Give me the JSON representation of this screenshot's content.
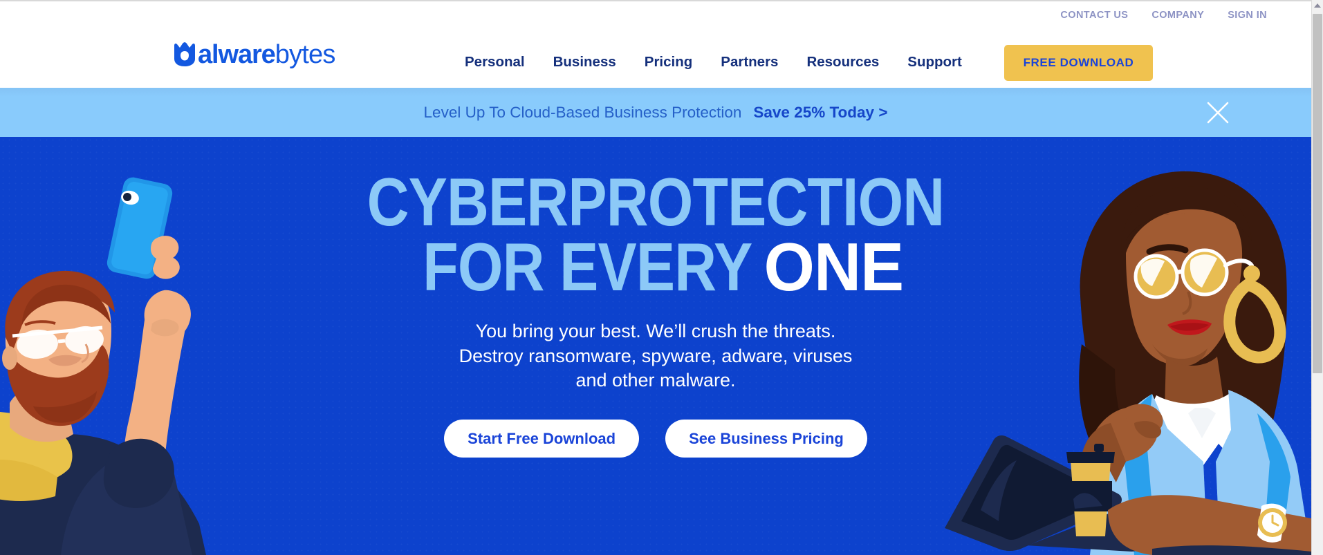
{
  "header": {
    "utility_nav": [
      {
        "label": "CONTACT US",
        "name": "contact-us"
      },
      {
        "label": "COMPANY",
        "name": "company"
      },
      {
        "label": "SIGN IN",
        "name": "sign-in"
      }
    ],
    "logo": {
      "bold_text": "alware",
      "light_text": "bytes",
      "mark": "malwarebytes-m-icon",
      "color": "#1358e0"
    },
    "main_nav": [
      {
        "label": "Personal"
      },
      {
        "label": "Business"
      },
      {
        "label": "Pricing"
      },
      {
        "label": "Partners"
      },
      {
        "label": "Resources"
      },
      {
        "label": "Support"
      }
    ],
    "cta": {
      "label": "FREE DOWNLOAD",
      "background": "#f0c24f",
      "text_color": "#1a44d8"
    }
  },
  "promo_banner": {
    "text": "Level Up To Cloud-Based Business Protection",
    "cta": "Save 25% Today >",
    "close_icon": "close-x-icon",
    "background": "#89cbfc",
    "text_color": "#2560c8"
  },
  "hero": {
    "headline_line1": "CYBERPROTECTION",
    "headline_line2_part1": "FOR EVERY",
    "headline_line2_part2": "ONE",
    "headline_color": "#8cc9f7",
    "headline_accent_color": "#ffffff",
    "background": "#0d42cd",
    "subheading_line1": "You bring your best. We’ll crush the threats.",
    "subheading_line2": "Destroy ransomware, spyware, adware, viruses",
    "subheading_line3": "and other malware.",
    "buttons": [
      {
        "label": "Start Free Download"
      },
      {
        "label": "See Business Pricing"
      }
    ],
    "illustration_left": "bearded-man-with-smartphone-illustration",
    "illustration_right": "woman-with-laptop-and-coffee-illustration"
  },
  "scrollbar": {
    "up_arrow": "scroll-up-arrow-icon",
    "thumb": "scroll-thumb"
  }
}
